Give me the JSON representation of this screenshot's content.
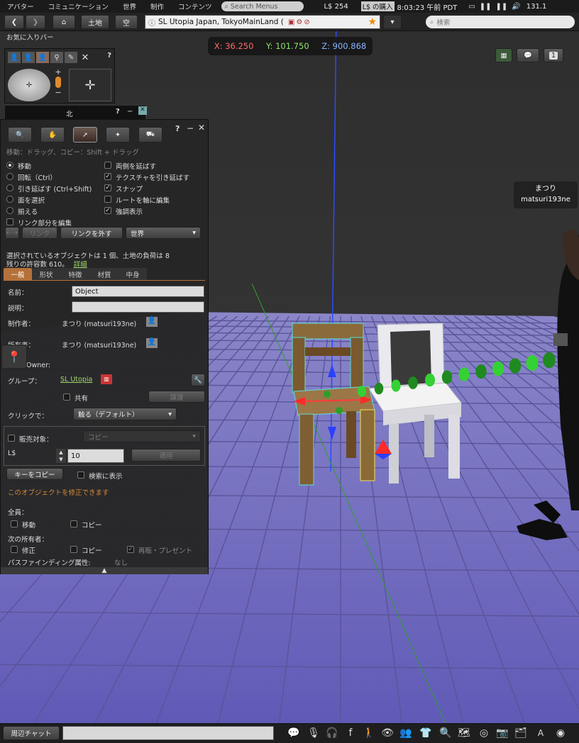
{
  "menubar": {
    "items": [
      "アバター",
      "コミュニケーション",
      "世界",
      "制作",
      "コンテンツ"
    ],
    "search_placeholder": "Search Menus",
    "balance": "L$ 254",
    "buy_label": "L$ の購入",
    "time": "8:03:23 午前 PDT",
    "fps": "131.1"
  },
  "navbar": {
    "land_label": "土地",
    "sky_label": "空",
    "location": "SL Utopia Japan, TokyoMainLand (",
    "search_placeholder": "検索"
  },
  "favorites": {
    "label": "お気に入りバー"
  },
  "coords": {
    "x": "X: 36.250",
    "y": "Y: 101.750",
    "z": "Z: 900.868"
  },
  "minimap": {
    "north": "北",
    "help": "?"
  },
  "nametag": {
    "display": "まつり",
    "user": "matsuri193ne"
  },
  "tool": {
    "help": "?",
    "hint": "移動：ドラッグ、コピー：Shift + ドラッグ",
    "modes": [
      "移動",
      "回転（Ctrl）",
      "引き延ばす (Ctrl+Shift)",
      "面を選択",
      "揃える"
    ],
    "edit_linked": "リンク部分を編集",
    "options": [
      "両側を延ばす",
      "テクスチャを引き延ばす",
      "スナップ",
      "ルートを軸に編集",
      "強調表示"
    ],
    "link_label": "リンク",
    "unlink_label": "リンクを外す",
    "coord_system": "世界",
    "selection_info": "選択されているオブジェクトは 1 個、土地の負荷は 8",
    "remaining": "残りの許容数 610。",
    "details_link": "詳細",
    "tabs": [
      "一般",
      "形状",
      "特徴",
      "材質",
      "中身"
    ],
    "name_label": "名前：",
    "name_value": "Object",
    "desc_label": "説明：",
    "creator_label": "制作者：",
    "creator_value": "まつり (matsuri193ne)",
    "owner_label": "所有者：",
    "owner_value": "まつり (matsuri193ne)",
    "owner_en": "Owner:",
    "group_label": "グループ：",
    "group_value": "SL Utopia",
    "share_label": "共有",
    "deed_label": "譲渡",
    "click_label": "クリックで：",
    "click_value": "触る（デフォルト）",
    "for_sale_label": "販売対象：",
    "sale_type": "コピー",
    "price_label": "L$",
    "price_value": "10",
    "apply_label": "適用",
    "copy_key_label": "キーをコピー",
    "show_search_label": "検索に表示",
    "modify_note": "このオブジェクトを修正できます",
    "everyone_label": "全員：",
    "move_label": "移動",
    "copy_label": "コピー",
    "next_owner_label": "次の所有者：",
    "modify_label": "修正",
    "resale_label": "再販・プレゼント",
    "pathfinding_label": "パスファインディング属性:",
    "pathfinding_value": "なし"
  },
  "bottombar": {
    "chat_label": "周辺チャット"
  },
  "colors": {
    "accent_green": "#9fd86f",
    "warning_orange": "#d08a3a",
    "panel_bg": "#262626",
    "coord_x": "#ff6b6b",
    "coord_y": "#8fe36f",
    "coord_z": "#8ab4ff"
  }
}
